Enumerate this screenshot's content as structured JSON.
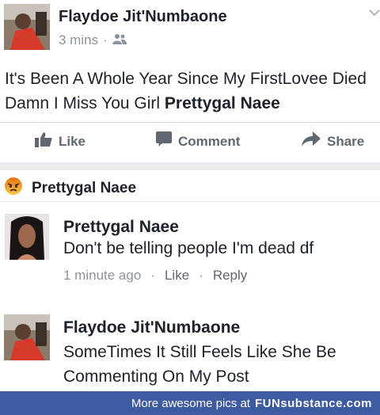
{
  "post": {
    "author": "Flaydoe Jit'Numbaone",
    "time": "3 mins",
    "separator": "·",
    "audience_icon": "friends-icon",
    "text_main": "It's Been A Whole Year Since My FirstLovee Died Damn I Miss You Girl ",
    "text_tag": "Prettygal Naee"
  },
  "actions": {
    "like": "Like",
    "comment": "Comment",
    "share": "Share"
  },
  "reaction": {
    "icon": "angry-face-icon",
    "name": "Prettygal Naee"
  },
  "comments": [
    {
      "author": "Prettygal Naee",
      "text": "Don't be telling people I'm dead df",
      "time": "1 minute ago",
      "dot": "·",
      "like": "Like",
      "reply": "Reply"
    },
    {
      "author": "Flaydoe Jit'Numbaone",
      "text": "SomeTimes It Still Feels Like She Be Commenting On My Post"
    }
  ],
  "footer": {
    "text": "More awesome pics at",
    "brand": "FUNsubstance.com"
  },
  "colors": {
    "text": "#1d2129",
    "meta": "#8d949e",
    "action": "#606770",
    "footer_bg": "#3e5aa0"
  }
}
